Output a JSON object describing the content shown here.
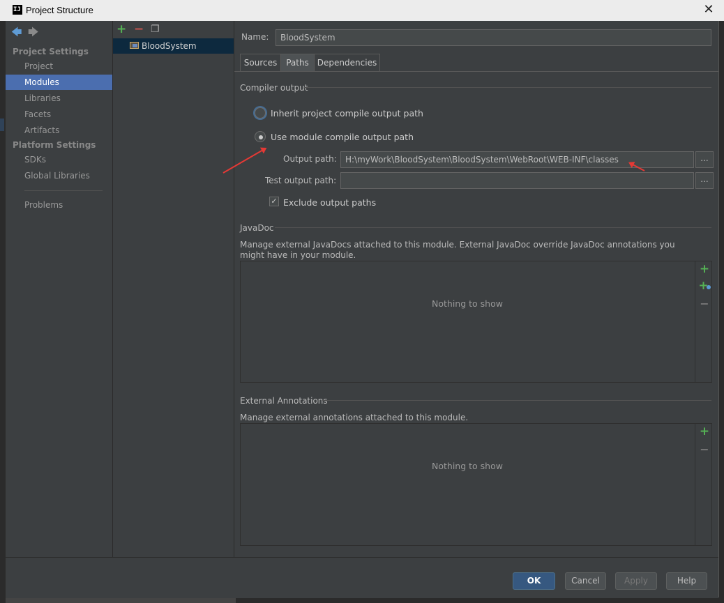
{
  "window": {
    "title": "Project Structure",
    "logo": "IJ",
    "close_icon": "close-icon"
  },
  "sidebar": {
    "project_settings_header": "Project Settings",
    "project_items": [
      "Project",
      "Modules",
      "Libraries",
      "Facets",
      "Artifacts"
    ],
    "platform_settings_header": "Platform Settings",
    "platform_items": [
      "SDKs",
      "Global Libraries"
    ],
    "other_items": [
      "Problems"
    ],
    "selected": "Modules"
  },
  "modules": {
    "items": [
      "BloodSystem"
    ],
    "selected": "BloodSystem"
  },
  "name_field": {
    "label": "Name:",
    "value": "BloodSystem"
  },
  "tabs": [
    "Sources",
    "Paths",
    "Dependencies"
  ],
  "active_tab": "Paths",
  "compiler_output": {
    "header": "Compiler output",
    "inherit_label": "Inherit project compile output path",
    "use_module_label": "Use module compile output path",
    "selected": "use_module",
    "output_path_label": "Output path:",
    "output_path_value": "H:\\myWork\\BloodSystem\\BloodSystem\\WebRoot\\WEB-INF\\classes",
    "test_output_path_label": "Test output path:",
    "test_output_path_value": "",
    "browse_label": "...",
    "exclude_label": "Exclude output paths",
    "exclude_checked": true
  },
  "javadoc": {
    "header": "JavaDoc",
    "description": "Manage external JavaDocs attached to this module. External JavaDoc override JavaDoc annotations you might have in your module.",
    "empty_text": "Nothing to show"
  },
  "external_annotations": {
    "header": "External Annotations",
    "description": "Manage external annotations attached to this module.",
    "empty_text": "Nothing to show"
  },
  "footer": {
    "ok": "OK",
    "cancel": "Cancel",
    "apply": "Apply",
    "help": "Help"
  },
  "colors": {
    "selection": "#4b6eaf",
    "accent_arrow": "#e53935",
    "add_green": "#55b155",
    "remove_red": "#c75450"
  }
}
